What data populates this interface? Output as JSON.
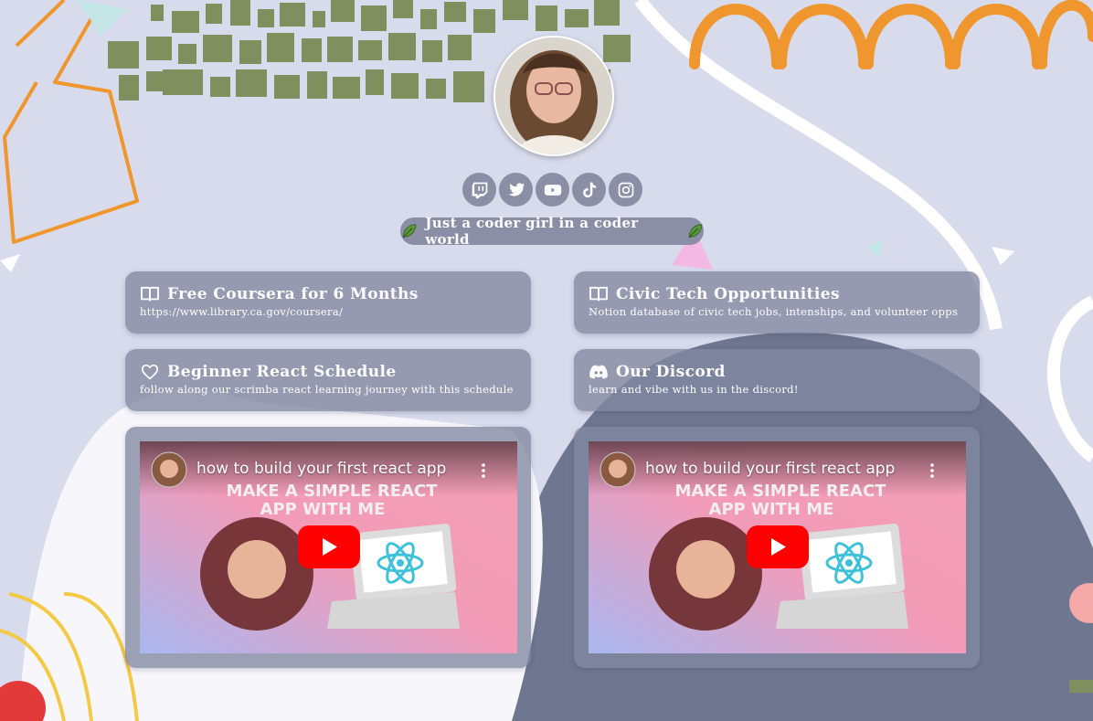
{
  "profile": {
    "avatar": "avatar-photo"
  },
  "socials": [
    {
      "name": "twitch",
      "icon": "twitch-icon"
    },
    {
      "name": "twitter",
      "icon": "twitter-icon"
    },
    {
      "name": "youtube",
      "icon": "youtube-icon"
    },
    {
      "name": "tiktok",
      "icon": "tiktok-icon"
    },
    {
      "name": "instagram",
      "icon": "instagram-icon"
    }
  ],
  "tagline": {
    "text": "Just a coder girl in a coder world",
    "icon": "leaf-icon"
  },
  "links": [
    {
      "title": "Free Coursera for 6 Months",
      "subtitle": "https://www.library.ca.gov/coursera/",
      "icon": "book-icon"
    },
    {
      "title": "Civic Tech Opportunities",
      "subtitle": "Notion database of civic tech jobs, intenships, and volunteer opps",
      "icon": "book-icon"
    },
    {
      "title": "Beginner React Schedule",
      "subtitle": "follow along our scrimba react learning journey with this schedule",
      "icon": "heart-icon"
    },
    {
      "title": "Our Discord",
      "subtitle": "learn and vibe with us in the discord!",
      "icon": "discord-icon"
    }
  ],
  "videos": [
    {
      "title": "how to build your first react app",
      "thumb_text": "MAKE A SIMPLE REACT APP WITH ME"
    },
    {
      "title": "how to build your first react app",
      "thumb_text": "MAKE A SIMPLE REACT APP WITH ME"
    }
  ],
  "colors": {
    "background": "#d8dbec",
    "card": "#8a8fa6",
    "olive": "#7f8f5e",
    "orange": "#f0962e",
    "dark_blob": "#6e7690",
    "youtube_red": "#ff0000"
  }
}
